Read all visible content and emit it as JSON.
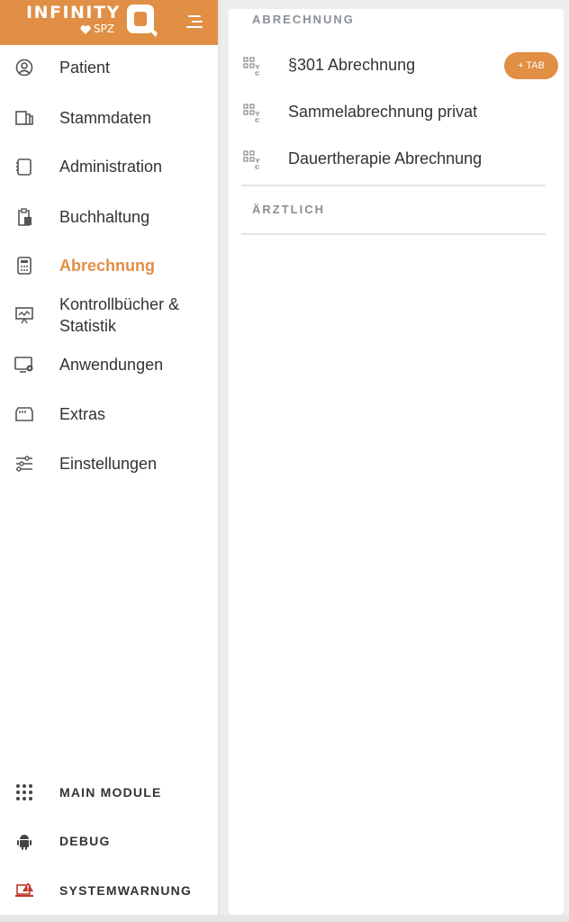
{
  "brand": {
    "name": "INFINITY",
    "sub": "SPZ",
    "color": "#e08f45"
  },
  "sidebar": {
    "items": [
      {
        "label": "Patient",
        "icon": "user-circle-icon"
      },
      {
        "label": "Stammdaten",
        "icon": "files-icon"
      },
      {
        "label": "Administration",
        "icon": "notebook-icon"
      },
      {
        "label": "Buchhaltung",
        "icon": "clipboard-calculator-icon"
      },
      {
        "label": "Abrechnung",
        "icon": "calculator-icon",
        "active": true
      },
      {
        "label": "Kontrollbücher & Statistik",
        "icon": "presentation-chart-icon"
      },
      {
        "label": "Anwendungen",
        "icon": "monitor-gear-icon"
      },
      {
        "label": "Extras",
        "icon": "folder-box-icon"
      },
      {
        "label": "Einstellungen",
        "icon": "sliders-icon"
      }
    ],
    "bottom": [
      {
        "label": "MAIN MODULE",
        "icon": "grid-dots-icon"
      },
      {
        "label": "DEBUG",
        "icon": "android-icon"
      },
      {
        "label": "SYSTEMWARNUNG",
        "icon": "laptop-warning-icon"
      }
    ]
  },
  "panel": {
    "sections": [
      {
        "title": "ABRECHNUNG",
        "entries": [
          {
            "label": "§301 Abrechnung",
            "icon": "qr-code-icon",
            "tab_label": "+ TAB"
          },
          {
            "label": "Sammelabrechnung privat",
            "icon": "qr-code-icon"
          },
          {
            "label": "Dauertherapie Abrechnung",
            "icon": "qr-code-icon"
          }
        ]
      },
      {
        "title": "ÄRZTLICH",
        "entries": []
      }
    ]
  },
  "colors": {
    "accent": "#e08f45",
    "text": "#333333",
    "muted": "#8a8f96",
    "warning_red": "#c0392b"
  }
}
